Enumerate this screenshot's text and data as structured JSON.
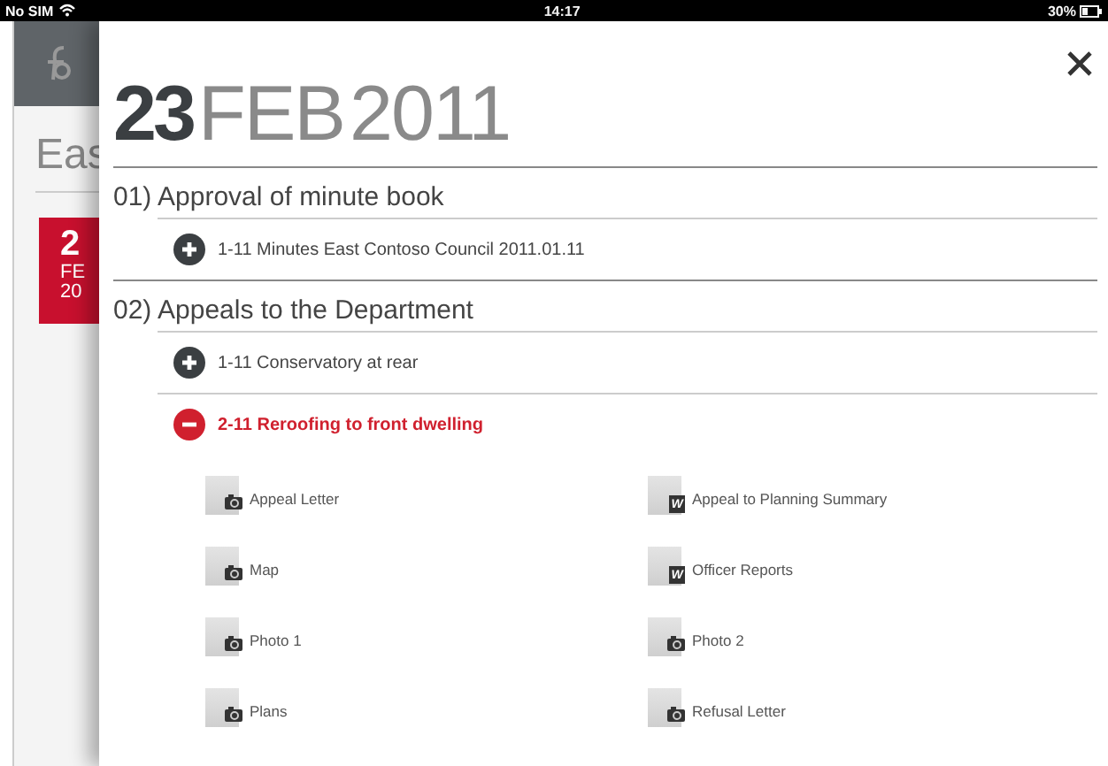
{
  "status_bar": {
    "carrier": "No SIM",
    "time": "14:17",
    "battery": "30%"
  },
  "background": {
    "heading": "Eas",
    "calendar": {
      "day": "2",
      "month": "FE",
      "year": "20"
    }
  },
  "dialog": {
    "date": {
      "day": "23",
      "month": "FEB",
      "year": "2011"
    },
    "sections": [
      {
        "title": "01) Approval of minute book",
        "items": [
          {
            "label": "1-11 Minutes East Contoso Council 2011.01.11",
            "expanded": false
          }
        ]
      },
      {
        "title": "02) Appeals to the Department",
        "items": [
          {
            "label": "1-11 Conservatory at rear",
            "expanded": false
          },
          {
            "label": "2-11 Reroofing to front dwelling",
            "expanded": true,
            "documents": [
              {
                "name": "Appeal Letter",
                "kind": "photo"
              },
              {
                "name": "Appeal to Planning Summary",
                "kind": "word",
                "badge": "W"
              },
              {
                "name": "Map",
                "kind": "photo"
              },
              {
                "name": "Officer Reports",
                "kind": "word",
                "badge": "W"
              },
              {
                "name": "Photo 1",
                "kind": "photo"
              },
              {
                "name": "Photo 2",
                "kind": "photo"
              },
              {
                "name": "Plans",
                "kind": "photo"
              },
              {
                "name": "Refusal Letter",
                "kind": "photo"
              }
            ]
          }
        ]
      }
    ]
  }
}
